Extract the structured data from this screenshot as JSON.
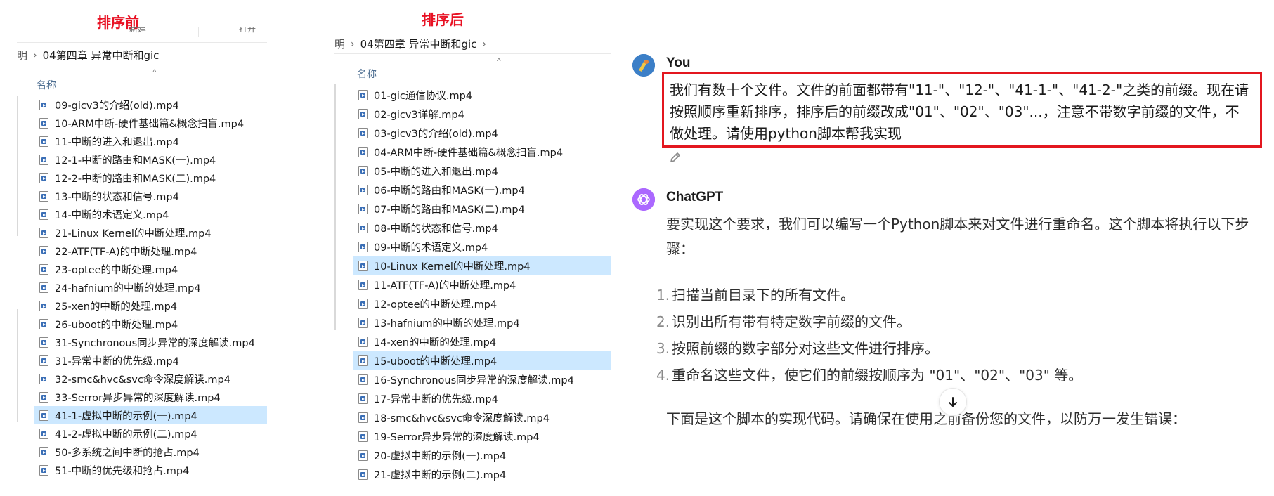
{
  "before_panel": {
    "title": "排序前",
    "toolbar": {
      "left_label": "新建",
      "right_label": "打开"
    },
    "breadcrumb": {
      "clipped": "明",
      "folder": "04第四章 异常中断和gic"
    },
    "column_header": "名称",
    "files": [
      {
        "name": "09-gicv3的介绍(old).mp4",
        "selected": false
      },
      {
        "name": "10-ARM中断-硬件基础篇&概念扫盲.mp4",
        "selected": false
      },
      {
        "name": "11-中断的进入和退出.mp4",
        "selected": false
      },
      {
        "name": "12-1-中断的路由和MASK(一).mp4",
        "selected": false
      },
      {
        "name": "12-2-中断的路由和MASK(二).mp4",
        "selected": false
      },
      {
        "name": "13-中断的状态和信号.mp4",
        "selected": false
      },
      {
        "name": "14-中断的术语定义.mp4",
        "selected": false
      },
      {
        "name": "21-Linux Kernel的中断处理.mp4",
        "selected": false
      },
      {
        "name": "22-ATF(TF-A)的中断处理.mp4",
        "selected": false
      },
      {
        "name": "23-optee的中断处理.mp4",
        "selected": false
      },
      {
        "name": "24-hafnium的中断的处理.mp4",
        "selected": false
      },
      {
        "name": "25-xen的中断的处理.mp4",
        "selected": false
      },
      {
        "name": "26-uboot的中断处理.mp4",
        "selected": false
      },
      {
        "name": "31-Synchronous同步异常的深度解读.mp4",
        "selected": false
      },
      {
        "name": "31-异常中断的优先级.mp4",
        "selected": false
      },
      {
        "name": "32-smc&hvc&svc命令深度解读.mp4",
        "selected": false
      },
      {
        "name": "33-Serror异步异常的深度解读.mp4",
        "selected": false
      },
      {
        "name": "41-1-虚拟中断的示例(一).mp4",
        "selected": true
      },
      {
        "name": "41-2-虚拟中断的示例(二).mp4",
        "selected": false
      },
      {
        "name": "50-多系统之间中断的抢占.mp4",
        "selected": false
      },
      {
        "name": "51-中断的优先级和抢占.mp4",
        "selected": false
      }
    ]
  },
  "after_panel": {
    "title": "排序后",
    "breadcrumb": {
      "clipped": "明",
      "folder": "04第四章 异常中断和gic"
    },
    "column_header": "名称",
    "files": [
      {
        "name": "01-gic通信协议.mp4",
        "selected": false
      },
      {
        "name": "02-gicv3详解.mp4",
        "selected": false
      },
      {
        "name": "03-gicv3的介绍(old).mp4",
        "selected": false
      },
      {
        "name": "04-ARM中断-硬件基础篇&概念扫盲.mp4",
        "selected": false
      },
      {
        "name": "05-中断的进入和退出.mp4",
        "selected": false
      },
      {
        "name": "06-中断的路由和MASK(一).mp4",
        "selected": false
      },
      {
        "name": "07-中断的路由和MASK(二).mp4",
        "selected": false
      },
      {
        "name": "08-中断的状态和信号.mp4",
        "selected": false
      },
      {
        "name": "09-中断的术语定义.mp4",
        "selected": false
      },
      {
        "name": "10-Linux Kernel的中断处理.mp4",
        "selected": true
      },
      {
        "name": "11-ATF(TF-A)的中断处理.mp4",
        "selected": false
      },
      {
        "name": "12-optee的中断处理.mp4",
        "selected": false
      },
      {
        "name": "13-hafnium的中断的处理.mp4",
        "selected": false
      },
      {
        "name": "14-xen的中断的处理.mp4",
        "selected": false
      },
      {
        "name": "15-uboot的中断处理.mp4",
        "selected": true
      },
      {
        "name": "16-Synchronous同步异常的深度解读.mp4",
        "selected": false
      },
      {
        "name": "17-异常中断的优先级.mp4",
        "selected": false
      },
      {
        "name": "18-smc&hvc&svc命令深度解读.mp4",
        "selected": false
      },
      {
        "name": "19-Serror异步异常的深度解读.mp4",
        "selected": false
      },
      {
        "name": "20-虚拟中断的示例(一).mp4",
        "selected": false
      },
      {
        "name": "21-虚拟中断的示例(二).mp4",
        "selected": false
      }
    ]
  },
  "chat": {
    "user_name": "You",
    "user_message": "我们有数十个文件。文件的前面都带有\"11-\"、\"12-\"、\"41-1-\"、\"41-2-\"之类的前缀。现在请按照顺序重新排序，排序后的前缀改成\"01\"、\"02\"、\"03\"...，注意不带数字前缀的文件，不做处理。请使用python脚本帮我实现",
    "assistant_name": "ChatGPT",
    "assistant_intro": "要实现这个要求，我们可以编写一个Python脚本来对文件进行重命名。这个脚本将执行以下步骤：",
    "steps": [
      {
        "num": "1.",
        "text": "扫描当前目录下的所有文件。"
      },
      {
        "num": "2.",
        "text": "识别出所有带有特定数字前缀的文件。"
      },
      {
        "num": "3.",
        "text": "按照前缀的数字部分对这些文件进行排序。"
      },
      {
        "num": "4.",
        "text": "重命名这些文件，使它们的前缀按顺序为 \"01\"、\"02\"、\"03\" 等。"
      }
    ],
    "assistant_outro": "下面是这个脚本的实现代码。请确保在使用之前备份您的文件，以防万一发生错误：",
    "highlight_color": "#e3171f",
    "icons": [
      "edit-icon",
      "arrow-down-icon",
      "openai-logo-icon",
      "user-avatar-icon"
    ]
  }
}
